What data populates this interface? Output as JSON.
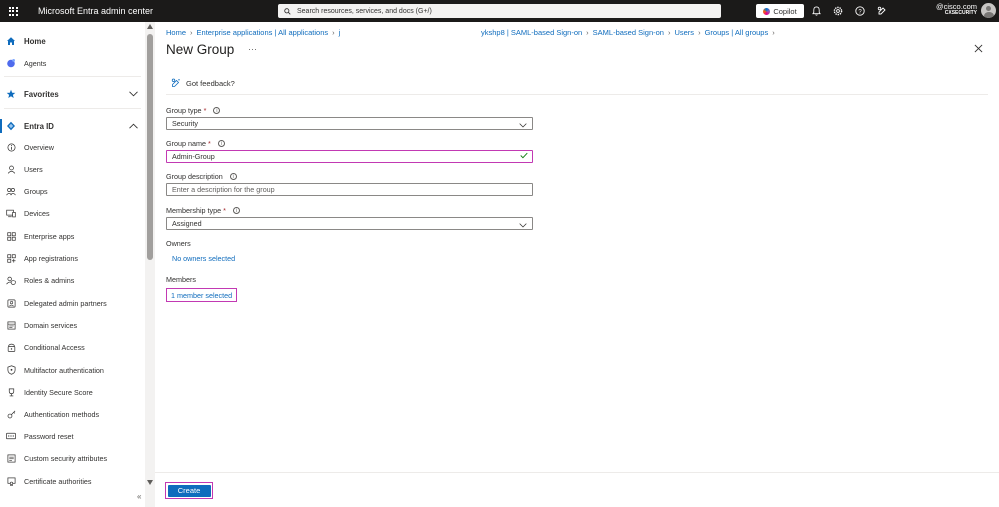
{
  "topbar": {
    "app_title": "Microsoft Entra admin center",
    "search_placeholder": "Search resources, services, and docs (G+/)",
    "copilot_label": "Copilot",
    "account_email": "@cisco.com",
    "account_tenant": "CXSECURITY"
  },
  "sidebar": {
    "home": "Home",
    "agents": "Agents",
    "favorites": "Favorites",
    "entra_id": "Entra ID",
    "items": [
      "Overview",
      "Users",
      "Groups",
      "Devices",
      "Enterprise apps",
      "App registrations",
      "Roles & admins",
      "Delegated admin partners",
      "Domain services",
      "Conditional Access",
      "Multifactor authentication",
      "Identity Secure Score",
      "Authentication methods",
      "Password reset",
      "Custom security attributes",
      "Certificate authorities"
    ],
    "collapse_glyph": "«"
  },
  "breadcrumb": {
    "items": [
      "Home",
      "Enterprise applications | All applications",
      "j",
      "ykshp8 | SAML-based Sign-on",
      "SAML-based Sign-on",
      "Users",
      "Groups | All groups"
    ]
  },
  "page": {
    "title": "New Group",
    "more_glyph": "···",
    "feedback_label": "Got feedback?"
  },
  "form": {
    "group_type_label": "Group type",
    "group_type_value": "Security",
    "group_name_label": "Group name",
    "group_name_value": "Admin-Group",
    "group_description_label": "Group description",
    "group_description_placeholder": "Enter a description for the group",
    "membership_type_label": "Membership type",
    "membership_type_value": "Assigned",
    "owners_label": "Owners",
    "owners_link": "No owners selected",
    "members_label": "Members",
    "members_link": "1 member selected",
    "required_mark": "*"
  },
  "footer": {
    "create_label": "Create"
  },
  "colors": {
    "accent": "#0f6cbd",
    "highlight": "#c239b3",
    "topbar": "#1b1a19"
  }
}
